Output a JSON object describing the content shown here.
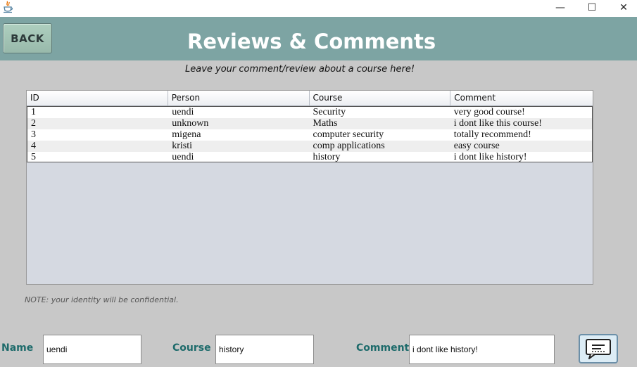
{
  "window": {
    "icon": "java-cup-icon",
    "minimize_glyph": "—",
    "maximize_glyph": "☐",
    "close_glyph": "✕"
  },
  "header": {
    "back_label": "BACK",
    "title": "Reviews & Comments",
    "subtitle": "Leave your comment/review about a course here!",
    "background_color": "#7da4a3"
  },
  "table": {
    "columns": [
      "ID",
      "Person",
      "Course",
      "Comment"
    ],
    "rows": [
      [
        "1",
        "uendi",
        "Security",
        "very good course!"
      ],
      [
        "2",
        "unknown",
        "Maths",
        "i dont like this course!"
      ],
      [
        "3",
        "migena",
        "computer security",
        "totally recommend!"
      ],
      [
        "4",
        "kristi",
        "comp applications",
        "easy course"
      ],
      [
        "5",
        "uendi",
        "history",
        "i dont like history!"
      ]
    ]
  },
  "note": "NOTE: your identity will be confidential.",
  "form": {
    "name_label": "Name",
    "name_value": "uendi",
    "course_label": "Course",
    "course_value": "history",
    "comment_label": "Comment",
    "comment_value": "i dont like history!",
    "submit_icon": "comment-bubble-icon",
    "label_color": "#1e6b6b"
  }
}
